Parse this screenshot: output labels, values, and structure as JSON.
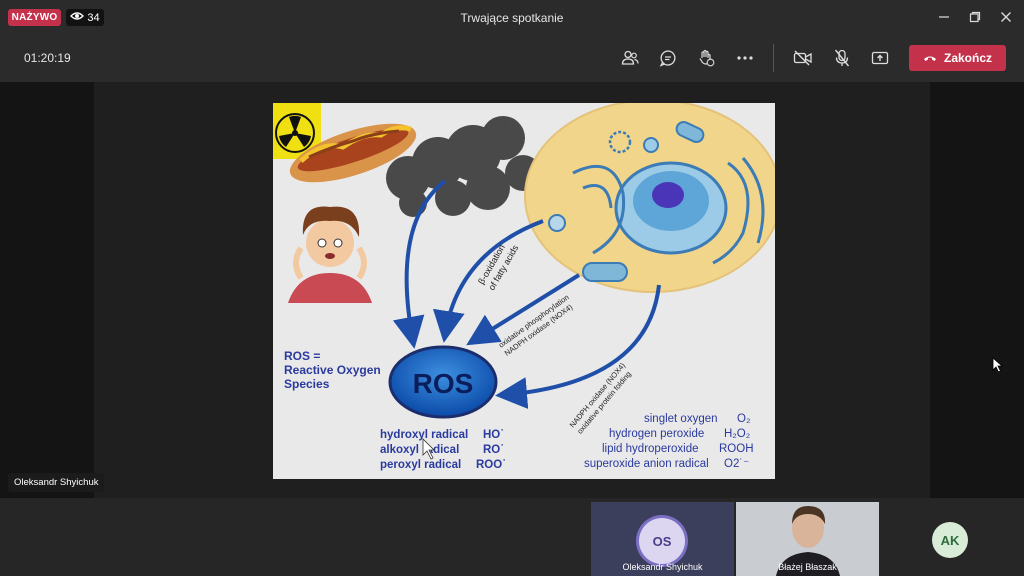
{
  "titlebar": {
    "live_badge": "NAŻYWO",
    "viewer_count": "34",
    "title": "Trwające spotkanie"
  },
  "toolbar": {
    "timer": "01:20:19",
    "leave_label": "Zakończ"
  },
  "slide": {
    "ros_label": "ROS",
    "ros_definition": [
      "ROS =",
      "Reactive Oxygen",
      "Species"
    ],
    "arrow_labels": {
      "beta": [
        "β-oxidation",
        "of fatty acids"
      ],
      "oxphos": [
        "oxidative phosphorylation",
        "NADPH oxidase (NOX4)"
      ],
      "nox": [
        "NADPH oxidase (NOX4)",
        "oxidative protein folding"
      ]
    },
    "radicals_left": [
      {
        "name": "hydroxyl radical",
        "formula": "HO˙"
      },
      {
        "name": "alkoxyl radical",
        "formula": "RO˙"
      },
      {
        "name": "peroxyl radical",
        "formula": "ROO˙"
      }
    ],
    "species_right": [
      {
        "name": "singlet oxygen",
        "formula": "O₂"
      },
      {
        "name": "hydrogen peroxide",
        "formula": "H₂O₂"
      },
      {
        "name": "lipid hydroperoxide",
        "formula": "ROOH"
      },
      {
        "name": "superoxide anion radical",
        "formula": "O2˙⁻"
      }
    ]
  },
  "participants": {
    "presenter_label": "Oleksandr Shyichuk",
    "tiles": [
      {
        "name": "Oleksandr Shyichuk",
        "initials": "OS"
      },
      {
        "name": "Błażej Błaszak",
        "initials": ""
      },
      {
        "name": "",
        "initials": "AK"
      }
    ]
  }
}
